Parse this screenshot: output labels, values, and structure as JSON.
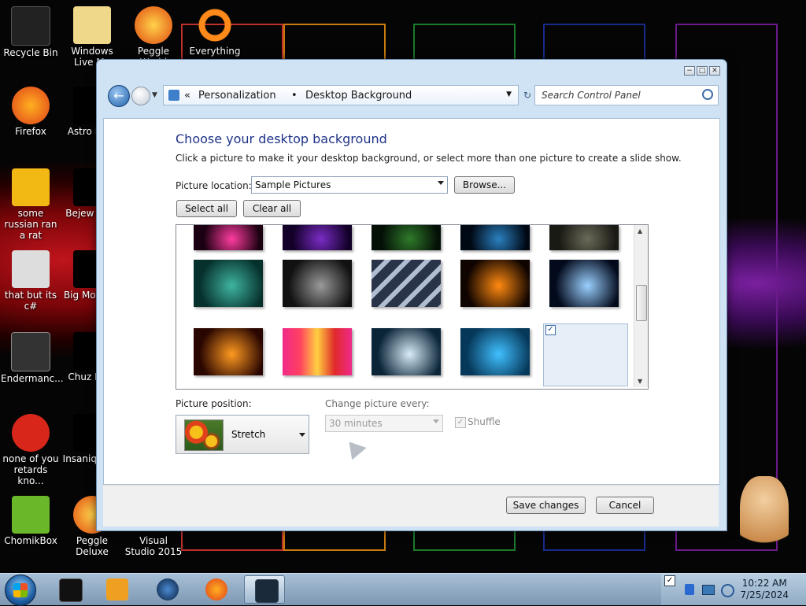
{
  "desktop": {
    "icons": [
      {
        "label": "Recycle Bin",
        "icon": "recycle-bin-icon"
      },
      {
        "label": "Windows Live Ma",
        "icon": "windows-live-icon"
      },
      {
        "label": "Peggle World",
        "icon": "peggle-icon"
      },
      {
        "label": "Everything",
        "icon": "everything-icon"
      },
      {
        "label": "Firefox",
        "icon": "firefox-icon"
      },
      {
        "label": "Astro Delu",
        "icon": "game-icon"
      },
      {
        "label": "some russian ran a rat",
        "icon": "file-icon"
      },
      {
        "label": "Bejew Delu",
        "icon": "game-icon"
      },
      {
        "label": "that but its c#",
        "icon": "folder-icon"
      },
      {
        "label": "Big Mo Delu",
        "icon": "game-icon"
      },
      {
        "label": "Endermanc...",
        "icon": "app-icon"
      },
      {
        "label": "Chuz Delu",
        "icon": "game-icon"
      },
      {
        "label": "none of you retards kno...",
        "icon": "app-icon"
      },
      {
        "label": "Insaniq Delu",
        "icon": "game-icon"
      },
      {
        "label": "ChomikBox",
        "icon": "chomikbox-icon"
      },
      {
        "label": "Peggle Deluxe",
        "icon": "peggle-icon"
      },
      {
        "label": "Visual Studio 2015",
        "icon": "visual-studio-icon"
      }
    ]
  },
  "window": {
    "controls": {
      "minimize": "−",
      "maximize": "□",
      "close": "✕"
    },
    "breadcrumb": {
      "overflow": "«",
      "item1": "Personalization",
      "separator": "•",
      "item2": "Desktop Background"
    },
    "search": {
      "placeholder": "Search Control Panel"
    },
    "heading": "Choose your desktop background",
    "subtext": "Click a picture to make it your desktop background, or select more than one picture to create a slide show.",
    "picture_location": {
      "label": "Picture location:",
      "value": "Sample Pictures",
      "browse": "Browse..."
    },
    "buttons": {
      "select_all": "Select all",
      "clear_all": "Clear all",
      "save": "Save changes",
      "cancel": "Cancel"
    },
    "position": {
      "label": "Picture position:",
      "value": "Stretch"
    },
    "change": {
      "label": "Change picture every:",
      "value": "30 minutes",
      "shuffle": "Shuffle"
    },
    "gallery": {
      "selected_index": 14,
      "thumbnails": [
        {
          "name": "wallpaper-pink-swirl",
          "colors": [
            "#1a0010",
            "#ff3ca0"
          ]
        },
        {
          "name": "wallpaper-purple-nebula",
          "colors": [
            "#120028",
            "#7a2cc4"
          ]
        },
        {
          "name": "wallpaper-green-particles",
          "colors": [
            "#041006",
            "#2f7a2a"
          ]
        },
        {
          "name": "wallpaper-blue-streak",
          "colors": [
            "#000814",
            "#2a80c0"
          ]
        },
        {
          "name": "wallpaper-grey-figure",
          "colors": [
            "#1a1a14",
            "#6a6a5a"
          ]
        },
        {
          "name": "wallpaper-green-orb",
          "colors": [
            "#06302c",
            "#3fb4a0"
          ]
        },
        {
          "name": "wallpaper-road",
          "colors": [
            "#111",
            "#9a9a9a"
          ]
        },
        {
          "name": "wallpaper-diagonal-stripes",
          "colors": [
            "#2a3448",
            "#b0bcd0"
          ]
        },
        {
          "name": "wallpaper-fire-rings",
          "colors": [
            "#100400",
            "#ff8a10"
          ]
        },
        {
          "name": "wallpaper-blue-burst",
          "colors": [
            "#030a1c",
            "#9ad0ff"
          ]
        },
        {
          "name": "wallpaper-orange-flare",
          "colors": [
            "#2a0600",
            "#ff9a20"
          ]
        },
        {
          "name": "wallpaper-color-bars",
          "colors": [
            "#f02a8a",
            "#ffd040"
          ]
        },
        {
          "name": "wallpaper-white-wave",
          "colors": [
            "#0a2438",
            "#d8ecf8"
          ]
        },
        {
          "name": "wallpaper-cyan-wave",
          "colors": [
            "#06385a",
            "#40c0ff"
          ]
        },
        {
          "name": "wallpaper-rainbow-blocks",
          "colors": [
            "#800808",
            "#3050c0"
          ]
        }
      ]
    }
  },
  "taskbar": {
    "items": [
      {
        "name": "start-button",
        "icon": "windows-orb-icon"
      },
      {
        "name": "taskbar-app-1",
        "icon": "explorer-icon"
      },
      {
        "name": "taskbar-app-2",
        "icon": "media-player-icon"
      },
      {
        "name": "taskbar-app-3",
        "icon": "globe-icon"
      },
      {
        "name": "taskbar-app-4",
        "icon": "firefox-icon"
      },
      {
        "name": "taskbar-app-5",
        "icon": "personalization-icon",
        "active": true
      }
    ],
    "clock": {
      "time": "10:22 AM",
      "date": "7/25/2024"
    }
  }
}
